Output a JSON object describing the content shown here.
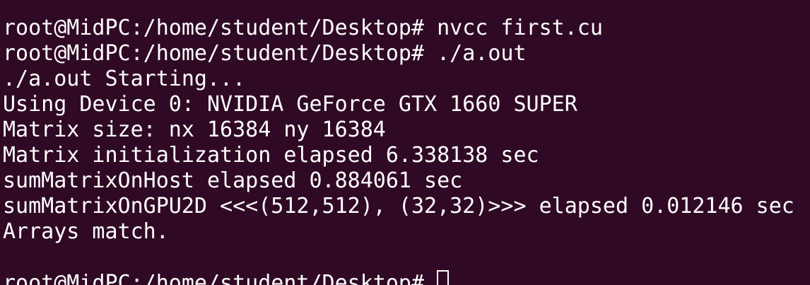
{
  "terminal": {
    "lines": [
      "",
      "root@MidPC:/home/student/Desktop# nvcc first.cu",
      "root@MidPC:/home/student/Desktop# ./a.out",
      "./a.out Starting...",
      "Using Device 0: NVIDIA GeForce GTX 1660 SUPER",
      "Matrix size: nx 16384 ny 16384",
      "Matrix initialization elapsed 6.338138 sec",
      "sumMatrixOnHost elapsed 0.884061 sec",
      "sumMatrixOnGPU2D <<<(512,512), (32,32)>>> elapsed 0.012146 sec",
      "Arrays match.",
      ""
    ],
    "prompt": "root@MidPC:/home/student/Desktop# "
  },
  "colors": {
    "background": "#300a24",
    "foreground": "#ffffff"
  }
}
